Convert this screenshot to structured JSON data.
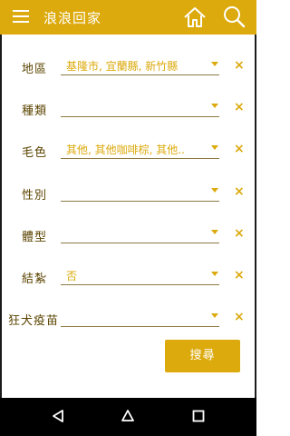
{
  "appbar": {
    "title": "浪浪回家",
    "menu_icon": "hamburger-menu-icon",
    "home_icon": "home-icon",
    "search_icon": "search-icon"
  },
  "filters": [
    {
      "label": "地區",
      "value": "基隆市, 宜蘭縣, 新竹縣",
      "clear": "×"
    },
    {
      "label": "種類",
      "value": "",
      "clear": "×"
    },
    {
      "label": "毛色",
      "value": "其他, 其他咖啡棕, 其他..",
      "clear": "×"
    },
    {
      "label": "性別",
      "value": "",
      "clear": "×"
    },
    {
      "label": "體型",
      "value": "",
      "clear": "×"
    },
    {
      "label": "結紮",
      "value": "否",
      "clear": "×"
    },
    {
      "label": "狂犬疫苗",
      "value": "",
      "clear": "×"
    }
  ],
  "search_button": "搜尋",
  "navbar": {
    "back_icon": "back-triangle-icon",
    "home_icon": "home-circle-icon",
    "recent_icon": "recent-apps-icon"
  },
  "colors": {
    "accent": "#dcaa0d",
    "label": "#5b4400",
    "underline": "#8c7a44",
    "navbar": "#000000"
  }
}
